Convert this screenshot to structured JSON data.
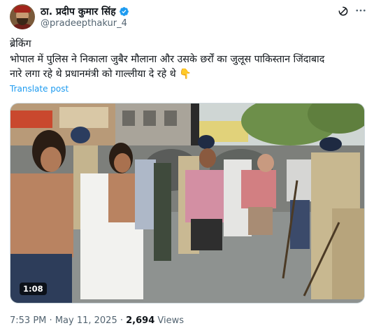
{
  "author": {
    "display_name": "ठा. प्रदीप कुमार सिंह",
    "handle": "@pradeepthakur_4",
    "verified": true,
    "avatar_icon": "profile-avatar"
  },
  "actions": {
    "grok_icon": "grok-icon",
    "more_icon": "more-icon"
  },
  "tweet": {
    "lines": [
      "ब्रेकिंग",
      "भोपाल में पुलिस ने निकाला जुबैर मौलाना और उसके छर्रों का जुलूस पाकिस्तान जिंदाबाद",
      "नारे लगा रहे थे प्रधानमंत्री को गाल्लीया दे रहे थे 👇"
    ],
    "translate_label": "Translate post"
  },
  "media": {
    "type": "video",
    "duration": "1:08"
  },
  "meta": {
    "time": "7:53 PM",
    "separator": "·",
    "date": "May 11, 2025",
    "views_count": "2,694",
    "views_label": "Views"
  },
  "colors": {
    "link": "#1d9bf0",
    "secondary_text": "#536471",
    "primary_text": "#0f1419",
    "verified_badge": "#1d9bf0"
  }
}
